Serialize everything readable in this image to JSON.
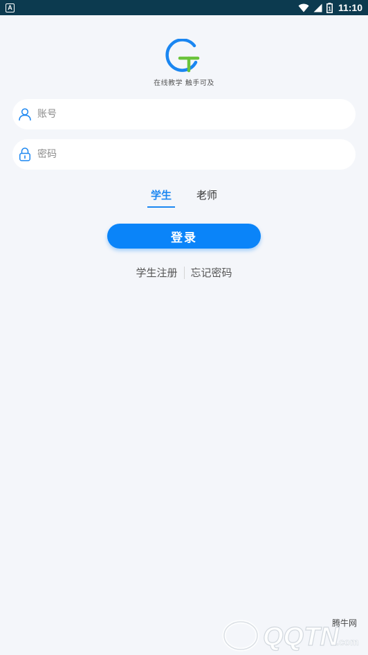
{
  "statusbar": {
    "app_icon": "A",
    "time": "11:10",
    "battery_level": "1",
    "icons": [
      "wifi-icon",
      "cell-signal-icon",
      "battery-icon"
    ]
  },
  "logo": {
    "tagline": "在线教学 触手可及",
    "colors": {
      "blue": "#1a86f1",
      "green": "#6ac33b"
    }
  },
  "form": {
    "account_placeholder": "账号",
    "password_placeholder": "密码",
    "account_value": "",
    "password_value": ""
  },
  "tabs": [
    {
      "label": "学生",
      "active": true
    },
    {
      "label": "老师",
      "active": false
    }
  ],
  "login_label": "登录",
  "links": {
    "register": "学生注册",
    "forgot": "忘记密码"
  },
  "watermark": {
    "text": "QQTN",
    "suffix": ".com",
    "cn": "腾牛网"
  },
  "colors": {
    "primary": "#0a84f9",
    "background": "#f4f6fa",
    "statusbar": "#0c3a4f"
  }
}
